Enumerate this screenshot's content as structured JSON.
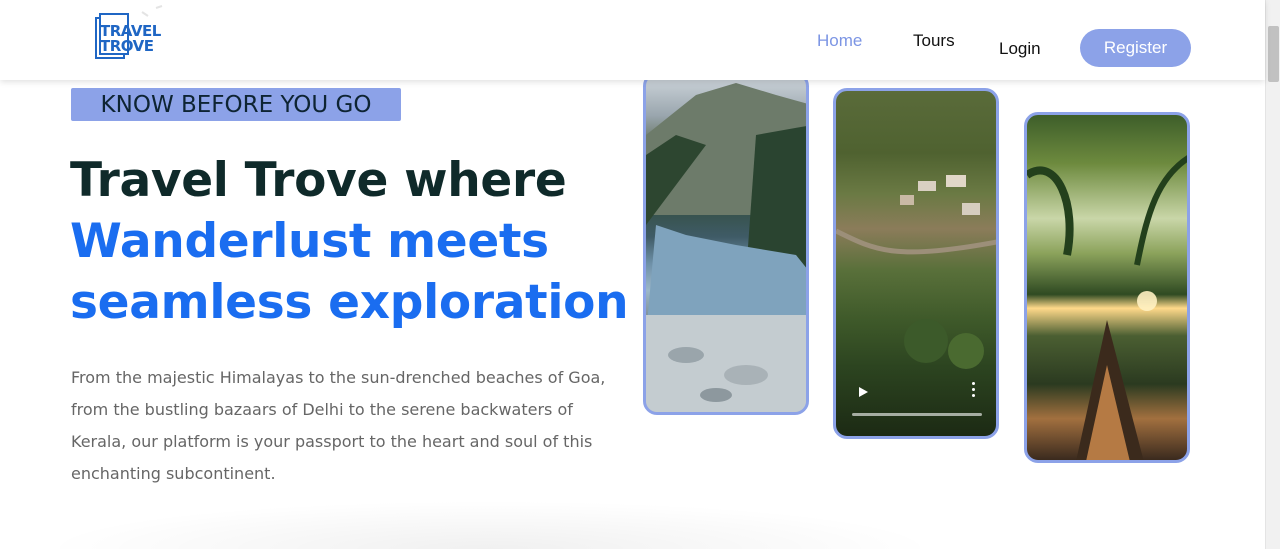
{
  "header": {
    "logo": {
      "line1": "TRAVEL",
      "line2": "TROVE"
    },
    "nav": {
      "home": "Home",
      "tours": "Tours",
      "login": "Login",
      "register": "Register"
    }
  },
  "hero": {
    "badge": "KNOW BEFORE YOU GO",
    "title_line1": "Travel Trove where",
    "title_line2": "Wanderlust meets",
    "title_line3": "seamless exploration",
    "description": "From the majestic Himalayas to the sun-drenched beaches of Goa, from the bustling bazaars of Delhi to the serene backwaters of Kerala, our platform is your passport to the heart and soul of this enchanting subcontinent."
  },
  "media": {
    "video_progress": 0
  },
  "colors": {
    "accent": "#8ca2e8",
    "title_blue": "#1a6df0",
    "title_dark": "#0f2a2a",
    "nav_active": "#7c95e4"
  }
}
